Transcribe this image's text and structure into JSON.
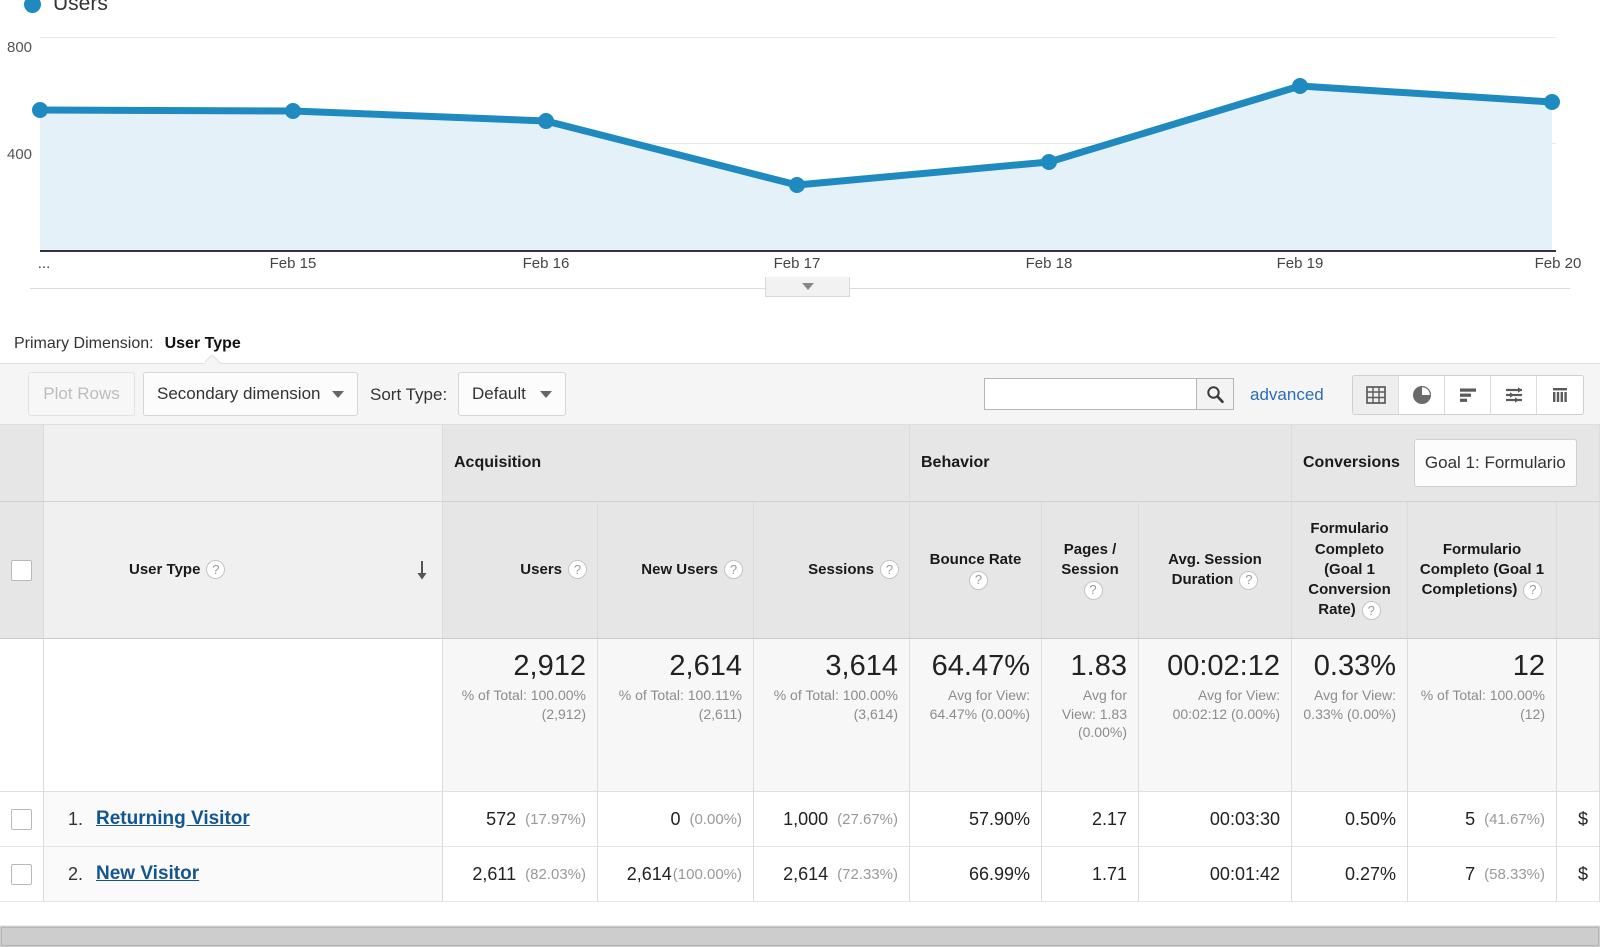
{
  "chart_data": {
    "type": "area",
    "title": "Users",
    "legend": [
      {
        "label": "Users",
        "color": "#1f8ac0"
      }
    ],
    "x": [
      "...",
      "Feb 15",
      "Feb 16",
      "Feb 17",
      "Feb 18",
      "Feb 19",
      "Feb 20"
    ],
    "categories": [
      "...",
      "Feb 15",
      "Feb 16",
      "Feb 17",
      "Feb 18",
      "Feb 19",
      "Feb 20"
    ],
    "series": [
      {
        "name": "Users",
        "values": [
          530,
          525,
          485,
          245,
          330,
          620,
          560
        ]
      }
    ],
    "values": [
      530,
      525,
      485,
      245,
      330,
      620,
      560
    ],
    "ylabel": "",
    "xlabel": "",
    "yticks": [
      "400",
      "800"
    ],
    "ytick_values": [
      400,
      800
    ],
    "ylim": [
      0,
      900
    ],
    "grid": true,
    "legend_position": "top-left",
    "line_color": "#1f8ac0",
    "fill_color": "#e5f1f9",
    "expander_icon": "caret-down-icon"
  },
  "primary_dimension": {
    "label": "Primary Dimension:",
    "value": "User Type"
  },
  "toolbar": {
    "plot_rows_label": "Plot Rows",
    "secondary_dimension_label": "Secondary dimension",
    "sort_type_label": "Sort Type:",
    "sort_type_value": "Default",
    "search_value": "",
    "search_placeholder": "",
    "search_icon": "search-icon",
    "advanced_label": "advanced",
    "view_icons": [
      {
        "name": "table-view-icon",
        "active": true
      },
      {
        "name": "pie-chart-view-icon",
        "active": false
      },
      {
        "name": "bar-chart-view-icon",
        "active": false
      },
      {
        "name": "comparison-view-icon",
        "active": false
      },
      {
        "name": "pivot-view-icon",
        "active": false
      }
    ]
  },
  "table": {
    "groups": [
      {
        "label": "Acquisition"
      },
      {
        "label": "Behavior"
      },
      {
        "label": "Conversions"
      }
    ],
    "goal_selector": "Goal 1: Formulario",
    "dimension_header": "User Type",
    "sort_direction": "descending",
    "columns": [
      {
        "label": "Users",
        "help": true
      },
      {
        "label": "New Users",
        "help": true
      },
      {
        "label": "Sessions",
        "help": true
      },
      {
        "label": "Bounce Rate",
        "help": true
      },
      {
        "label": "Pages / Session",
        "help": true
      },
      {
        "label": "Avg. Session Duration",
        "help": true
      },
      {
        "label": "Formulario Completo (Goal 1 Conversion Rate)",
        "help": true
      },
      {
        "label": "Formulario Completo (Goal 1 Completions)",
        "help": true
      }
    ],
    "summary": [
      {
        "value": "2,912",
        "sub": "% of Total: 100.00% (2,912)"
      },
      {
        "value": "2,614",
        "sub": "% of Total: 100.11% (2,611)"
      },
      {
        "value": "3,614",
        "sub": "% of Total: 100.00% (3,614)"
      },
      {
        "value": "64.47%",
        "sub": "Avg for View: 64.47% (0.00%)"
      },
      {
        "value": "1.83",
        "sub": "Avg for View: 1.83 (0.00%)"
      },
      {
        "value": "00:02:12",
        "sub": "Avg for View: 00:02:12 (0.00%)"
      },
      {
        "value": "0.33%",
        "sub": "Avg for View: 0.33% (0.00%)"
      },
      {
        "value": "12",
        "sub": "% of Total: 100.00% (12)"
      }
    ],
    "rows": [
      {
        "index": "1.",
        "name": "Returning Visitor",
        "users": "572",
        "users_pct": "(17.97%)",
        "new_users": "0",
        "new_users_pct": "(0.00%)",
        "sessions": "1,000",
        "sessions_pct": "(27.67%)",
        "bounce_rate": "57.90%",
        "pages_session": "2.17",
        "avg_duration": "00:03:30",
        "goal_rate": "0.50%",
        "goal_completions": "5",
        "goal_completions_pct": "(41.67%)",
        "goal_value": "$"
      },
      {
        "index": "2.",
        "name": "New Visitor",
        "users": "2,611",
        "users_pct": "(82.03%)",
        "new_users": "2,614",
        "new_users_pct": "(100.00%)",
        "sessions": "2,614",
        "sessions_pct": "(72.33%)",
        "bounce_rate": "66.99%",
        "pages_session": "1.71",
        "avg_duration": "00:01:42",
        "goal_rate": "0.27%",
        "goal_completions": "7",
        "goal_completions_pct": "(58.33%)",
        "goal_value": "$"
      }
    ]
  },
  "colors": {
    "accent": "#1f8ac0",
    "link": "#14568f",
    "advanced_link": "#2a6ebb",
    "area_fill": "#e5f1f9"
  }
}
